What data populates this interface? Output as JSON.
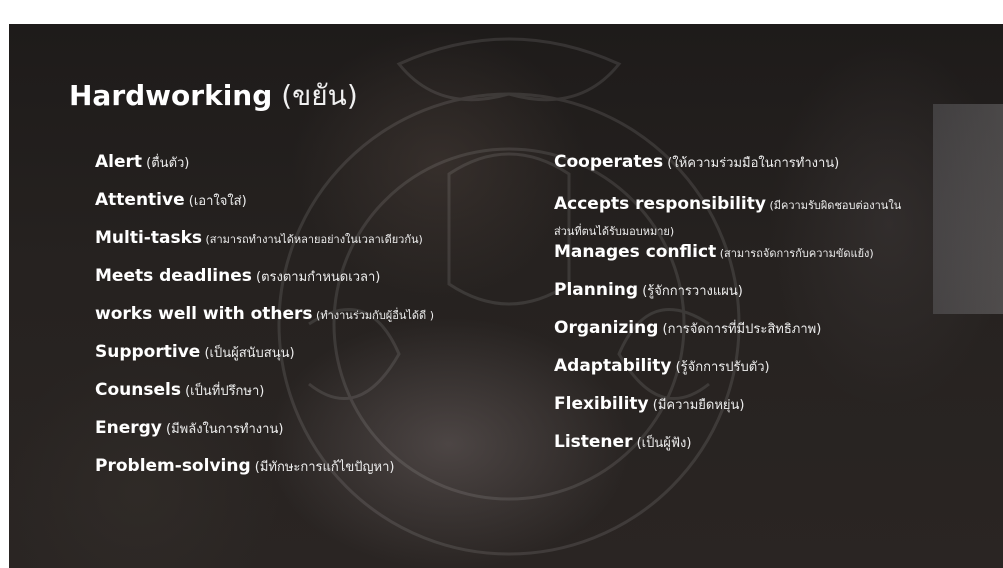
{
  "slide": {
    "title_en": "Hardworking",
    "title_th": "(ขยัน)",
    "left_items": [
      {
        "en": "Alert",
        "th": "  (ตื่นตัว)"
      },
      {
        "en": "Attentive",
        "th": "  (เอาใจใส่)"
      },
      {
        "en": "Multi-tasks",
        "th": " (สามารถทำงานได้หลายอย่างในเวลาเดียวกัน)"
      },
      {
        "en": "Meets deadlines",
        "th": "  (ตรงตามกำหนดเวลา)"
      },
      {
        "en": "works well with others",
        "th": " (ทำงานร่วมกับผู้อื่นได้ดี )"
      },
      {
        "en": "Supportive",
        "th": " (เป็นผู้สนับสนุน)"
      },
      {
        "en": "Counsels",
        "th": "   (เป็นที่ปรึกษา)"
      },
      {
        "en": "Energy",
        "th": " (มีพลังในการทำงาน)"
      },
      {
        "en": "Problem-solving",
        "th": " (มีทักษะการแก้ไขปัญหา)"
      }
    ],
    "right_items": [
      {
        "en": "Cooperates",
        "th": "  (ให้ความร่วมมือในการทำงาน)"
      },
      {
        "en": "Accepts responsibility",
        "th": "  (มีความรับผิดชอบต่องานใน",
        "cont": "ส่วนที่ตนได้รับมอบหมาย)"
      },
      {
        "en": "Manages conflict",
        "th": " (สามารถจัดการกับความขัดแย้ง)"
      },
      {
        "en": "Planning",
        "th": " (รู้จักการวางแผน)"
      },
      {
        "en": "Organizing",
        "th": " (การจัดการที่มีประสิทธิภาพ)"
      },
      {
        "en": "Adaptability",
        "th": " (รู้จักการปรับตัว)"
      },
      {
        "en": "Flexibility",
        "th": " (มีความยืดหยุ่น)"
      },
      {
        "en": "Listener",
        "th": " (เป็นผู้ฟัง)"
      }
    ]
  }
}
